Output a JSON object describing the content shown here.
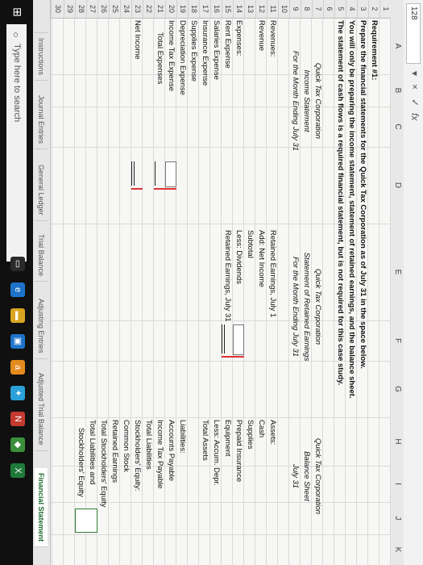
{
  "formula_bar": {
    "name_box": "128",
    "cancel": "×",
    "enter": "✓",
    "fx": "fx"
  },
  "columns": [
    "A",
    "B",
    "C",
    "D",
    "E",
    "F",
    "G",
    "H",
    "I",
    "J",
    "K"
  ],
  "rows": [
    "1",
    "2",
    "3",
    "4",
    "5",
    "6",
    "7",
    "8",
    "9",
    "10",
    "11",
    "12",
    "13",
    "14",
    "15",
    "16",
    "17",
    "18",
    "19",
    "20",
    "21",
    "22",
    "23",
    "24",
    "25",
    "26",
    "27",
    "28",
    "29",
    "30"
  ],
  "header": {
    "requirement": "Requirement #1:",
    "instr1": "Prepare the financial statements for the Quick Tax Corporation as of July 31 in the space below.",
    "instr2": "You will only be preparing the income statement, statement of retained earnings, and the balance sheet.",
    "instr3": "The statement of cash flows is a required financial statement, but is not required for this case study."
  },
  "income": {
    "title1": "Quick Tax Corporation",
    "title2": "Income Statement",
    "title3": "For the Month Ending July 31",
    "revenues": "Revenues:",
    "revenue": "Revenue",
    "expenses": "Expenses:",
    "items": [
      "Rent Expense",
      "Salaries Expense",
      "Insurance Expense",
      "Supplies Expense",
      "Depreciation Expense",
      "Income Tax Expense"
    ],
    "total": "Total Expenses",
    "net": "Net Income"
  },
  "retained": {
    "title1": "Quick Tax Corporation",
    "title2": "Statement of Retained Earnings",
    "title3": "For the Month Ending July 31",
    "items": [
      "Retained Earnings, July 1",
      "Add: Net Income",
      "Subtotal",
      "Less: Dividends",
      "Retained Earnings, July 31"
    ]
  },
  "balance": {
    "title1": "Quick Tax Corporation",
    "title2": "Balance Sheet",
    "title3": "July 31",
    "assets_head": "Assets:",
    "assets": [
      "Cash",
      "Supplies",
      "Prepaid Insurance",
      "Equipment",
      "Less: Accum. Depr.",
      "Total Assets"
    ],
    "liab_head": "Liabilities:",
    "liab": [
      "Accounts Payable",
      "Income Tax Payable",
      "Total Liabilities"
    ],
    "equity_head": "Stockholders' Equity:",
    "equity": [
      "Common Stock",
      "Retained Earnings",
      "Total Stockholders' Equity",
      "Total Liabilities and",
      "Stockholders' Equity"
    ]
  },
  "tabs": [
    "Instructions",
    "Journal Entries",
    "General Ledger",
    "Trial Balance",
    "Adjusting Entries",
    "Adjusted Trial Balance",
    "Financial Statement"
  ],
  "taskbar": {
    "search_placeholder": "Type here to search"
  }
}
